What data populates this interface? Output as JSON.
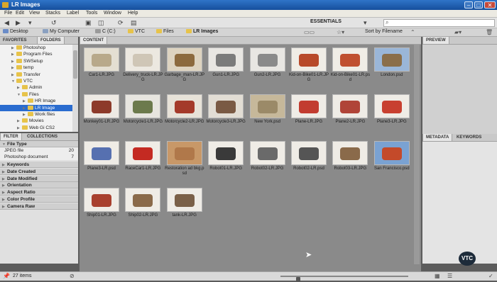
{
  "window": {
    "title": "LR Images"
  },
  "menu": [
    "File",
    "Edit",
    "View",
    "Stacks",
    "Label",
    "Tools",
    "Window",
    "Help"
  ],
  "toolbar": {
    "workspace": "ESSENTIALS",
    "search_placeholder": "",
    "sort_label": "Sort by Filename"
  },
  "path": [
    "Desktop",
    "My Computer",
    "C (C:)",
    "VTC",
    "Files",
    "LR Images"
  ],
  "left_tabs": [
    "FAVORITES",
    "FOLDERS"
  ],
  "folders": [
    {
      "label": "Photoshop",
      "indent": 2,
      "expanded": false
    },
    {
      "label": "Program Files",
      "indent": 2,
      "expanded": false
    },
    {
      "label": "SWSetup",
      "indent": 2,
      "expanded": false
    },
    {
      "label": "temp",
      "indent": 2,
      "expanded": false
    },
    {
      "label": "Transfer",
      "indent": 2,
      "expanded": false
    },
    {
      "label": "VTC",
      "indent": 2,
      "expanded": true
    },
    {
      "label": "Admin",
      "indent": 3,
      "expanded": false
    },
    {
      "label": "Files",
      "indent": 3,
      "expanded": true
    },
    {
      "label": "HR Image",
      "indent": 4,
      "expanded": false
    },
    {
      "label": "LR Image",
      "indent": 4,
      "expanded": false,
      "selected": true
    },
    {
      "label": "Work files",
      "indent": 4,
      "expanded": false
    },
    {
      "label": "Movies",
      "indent": 3,
      "expanded": false
    },
    {
      "label": "Web Gi CS2",
      "indent": 3,
      "expanded": false
    }
  ],
  "filter_tabs": [
    "FILTER",
    "COLLECTIONS"
  ],
  "filters": {
    "head": "File Type",
    "file_types": [
      {
        "label": "JPEG file",
        "count": "20"
      },
      {
        "label": "Photoshop document",
        "count": "7"
      }
    ],
    "categories": [
      "Keywords",
      "Date Created",
      "Date Modified",
      "Orientation",
      "Aspect Ratio",
      "Color Profile",
      "Camera Raw"
    ]
  },
  "content_tab": "CONTENT",
  "items": [
    {
      "name": "Car1-LR.JPG",
      "color": "#e4dfd2",
      "accent": "#b8a98a"
    },
    {
      "name": "Delivery_truck-LR.JPG",
      "color": "#ece8e0",
      "accent": "#cfc6b6"
    },
    {
      "name": "Garbage_man-LR.JPG",
      "color": "#ddd3c0",
      "accent": "#8c6a3e"
    },
    {
      "name": "Gun1-LR.JPG",
      "color": "#e8e6e2",
      "accent": "#7b7b7b"
    },
    {
      "name": "Gun2-LR.JPG",
      "color": "#e8e6e2",
      "accent": "#8a8a8a"
    },
    {
      "name": "Kid-on-Bike01-LR.JPG",
      "color": "#f0ede6",
      "accent": "#b84a2a"
    },
    {
      "name": "Kid-on-Bike01-LR.psd",
      "color": "#f0ede6",
      "accent": "#c05030"
    },
    {
      "name": "London.psd",
      "color": "#9ab6d8",
      "accent": "#8a6e4a"
    },
    {
      "name": "Monkey01-LR.JPG",
      "color": "#eeeae4",
      "accent": "#8d3a2a"
    },
    {
      "name": "Motorcycle1-LR.JPG",
      "color": "#e7e5df",
      "accent": "#6c7a4c"
    },
    {
      "name": "Motorcycle2-LR.JPG",
      "color": "#e7e2d8",
      "accent": "#a43a2a"
    },
    {
      "name": "Motorcycle3-LR.JPG",
      "color": "#e2ddd4",
      "accent": "#7a5a44"
    },
    {
      "name": "New York.psd",
      "color": "#c6b89a",
      "accent": "#9b8a68"
    },
    {
      "name": "Plane-LR.JPG",
      "color": "#efece6",
      "accent": "#c23c30"
    },
    {
      "name": "Plane2-LR.JPG",
      "color": "#efece6",
      "accent": "#b04438"
    },
    {
      "name": "Plane3-LR.JPG",
      "color": "#efece6",
      "accent": "#c84030"
    },
    {
      "name": "Plane3-LR.psd",
      "color": "#efece6",
      "accent": "#5670b0"
    },
    {
      "name": "RaceCar1-LR.JPG",
      "color": "#efece6",
      "accent": "#c42a22"
    },
    {
      "name": "Restoration ad bkg.psd",
      "color": "#c89868",
      "accent": "#b0784a"
    },
    {
      "name": "Robot01-LR.JPG",
      "color": "#efece6",
      "accent": "#3a3a3a"
    },
    {
      "name": "Robot02-LR.JPG",
      "color": "#efece6",
      "accent": "#6a6a6a"
    },
    {
      "name": "Robot02-LR.psd",
      "color": "#efece6",
      "accent": "#555555"
    },
    {
      "name": "Robot03-LR.JPG",
      "color": "#efece6",
      "accent": "#8a6a4a"
    },
    {
      "name": "San Francisco.psd",
      "color": "#7aa2d2",
      "accent": "#c44a2a"
    },
    {
      "name": "Ship01-LR.JPG",
      "color": "#efece6",
      "accent": "#a8402e"
    },
    {
      "name": "Ship02-LR.JPG",
      "color": "#efece6",
      "accent": "#8a6a4a"
    },
    {
      "name": "tank-LR.JPG",
      "color": "#efece6",
      "accent": "#7a6048"
    }
  ],
  "right_tabs": {
    "preview": "PREVIEW",
    "metadata": "METADATA",
    "keywords": "KEYWORDS"
  },
  "logo_text": "VTC",
  "status": {
    "items_count": "27 items"
  },
  "zoom_fraction": 0.12
}
